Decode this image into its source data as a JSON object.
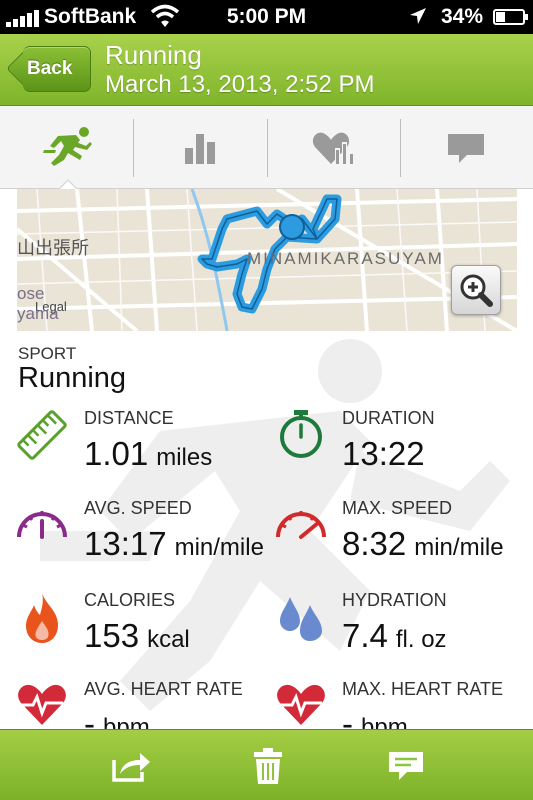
{
  "status_bar": {
    "carrier": "SoftBank",
    "time": "5:00 PM",
    "battery": "34%"
  },
  "header": {
    "back_label": "Back",
    "title": "Running",
    "subtitle": "March 13, 2013, 2:52 PM"
  },
  "tabs": [
    {
      "name": "summary",
      "icon": "runner-icon",
      "active": true
    },
    {
      "name": "charts",
      "icon": "bar-chart-icon",
      "active": false
    },
    {
      "name": "heart-rate",
      "icon": "heart-chart-icon",
      "active": false
    },
    {
      "name": "comments",
      "icon": "speech-bubble-icon",
      "active": false
    }
  ],
  "map": {
    "place_label": "山出張所",
    "district_label": "MINAMIKARASUYAM",
    "legal_label": "Legal",
    "partial_label_1": "ose",
    "partial_label_2": "yama"
  },
  "sport": {
    "label": "SPORT",
    "value": "Running"
  },
  "stats": [
    {
      "label": "DISTANCE",
      "value": "1.01",
      "unit": "miles",
      "icon": "ruler-icon",
      "color": "#5aa02c"
    },
    {
      "label": "DURATION",
      "value": "13:22",
      "unit": "",
      "icon": "stopwatch-icon",
      "color": "#1e7a3a"
    },
    {
      "label": "AVG. SPEED",
      "value": "13:17",
      "unit": "min/mile",
      "icon": "speedometer-icon",
      "color": "#8a2a8a"
    },
    {
      "label": "MAX. SPEED",
      "value": "8:32",
      "unit": "min/mile",
      "icon": "speedometer-max-icon",
      "color": "#d22a2a"
    },
    {
      "label": "CALORIES",
      "value": "153",
      "unit": "kcal",
      "icon": "flame-icon",
      "color": "#e8541c"
    },
    {
      "label": "HYDRATION",
      "value": "7.4",
      "unit": "fl. oz",
      "icon": "water-drops-icon",
      "color": "#6a8ad0"
    },
    {
      "label": "AVG. HEART RATE",
      "value": "-",
      "unit": "bpm",
      "icon": "heart-pulse-icon",
      "color": "#d32a3a"
    },
    {
      "label": "MAX. HEART RATE",
      "value": "-",
      "unit": "bpm",
      "icon": "heart-pulse-max-icon",
      "color": "#d32a3a"
    }
  ],
  "toolbar": {
    "share": "share-icon",
    "delete": "trash-icon",
    "comment": "comment-icon"
  },
  "colors": {
    "accent_green": "#8cc63f",
    "route_blue": "#2c9be0"
  }
}
